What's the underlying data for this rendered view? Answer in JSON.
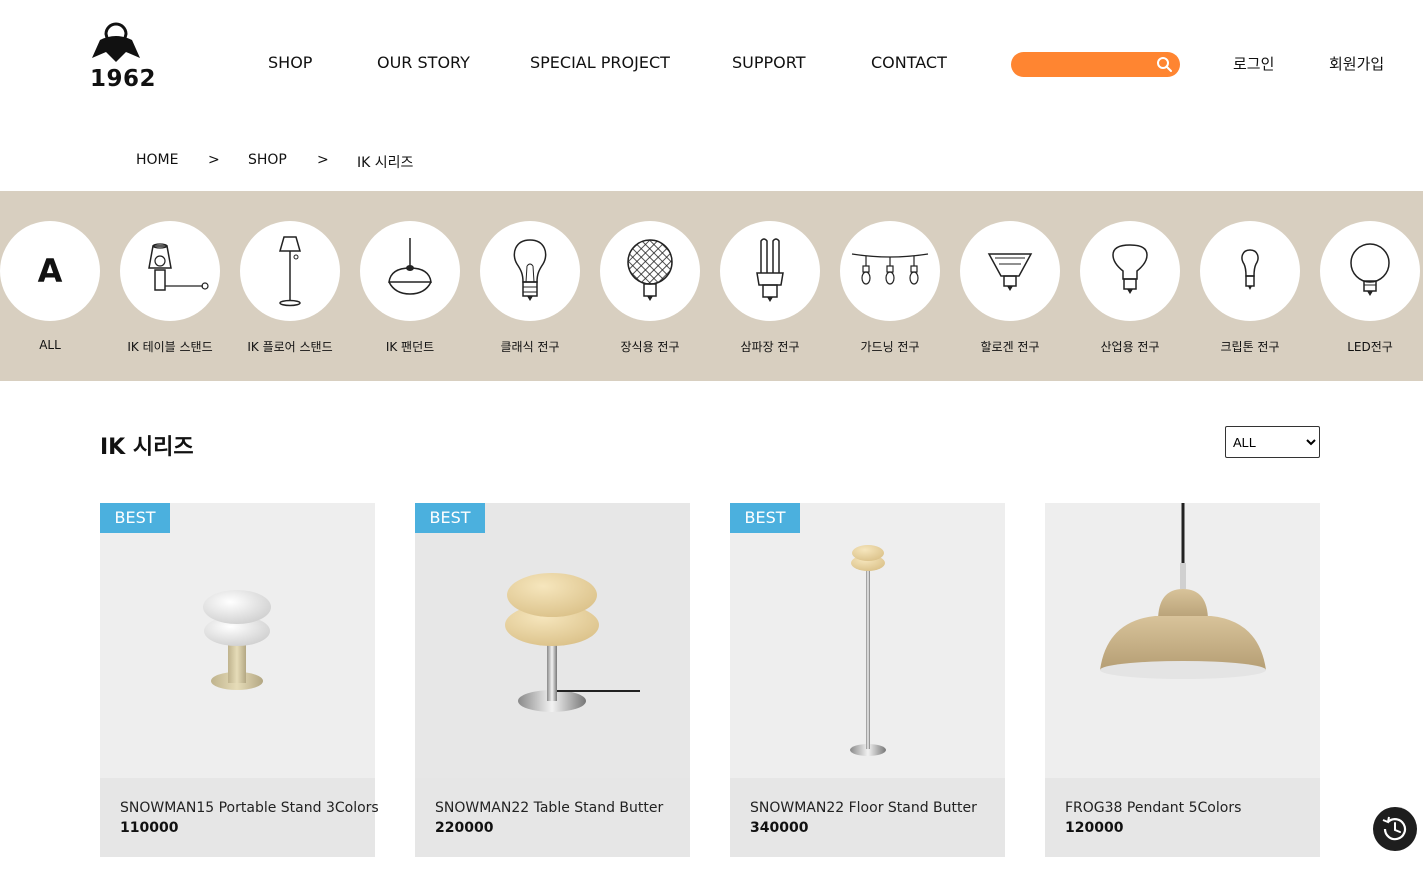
{
  "brand": {
    "year": "1962"
  },
  "nav": {
    "items": [
      {
        "label": "SHOP"
      },
      {
        "label": "OUR STORY"
      },
      {
        "label": "SPECIAL PROJECT"
      },
      {
        "label": "SUPPORT"
      },
      {
        "label": "CONTACT"
      }
    ]
  },
  "search": {
    "placeholder": "",
    "value": ""
  },
  "auth": {
    "login": "로그인",
    "signup": "회원가입"
  },
  "breadcrumb": {
    "home": "HOME",
    "sep1": ">",
    "shop": "SHOP",
    "sep2": ">",
    "current": "IK 시리즈"
  },
  "categories": [
    {
      "label": "ALL",
      "icon": "letter-a-icon",
      "glyph": "A"
    },
    {
      "label": "IK 테이블 스탠드",
      "icon": "table-lamp-icon"
    },
    {
      "label": "IK 플로어 스탠드",
      "icon": "floor-lamp-icon"
    },
    {
      "label": "IK 팬던트",
      "icon": "pendant-lamp-icon"
    },
    {
      "label": "클래식 전구",
      "icon": "classic-bulb-icon"
    },
    {
      "label": "장식용 전구",
      "icon": "decorative-bulb-icon"
    },
    {
      "label": "삼파장 전구",
      "icon": "cfl-bulb-icon"
    },
    {
      "label": "가드닝 전구",
      "icon": "string-lights-icon"
    },
    {
      "label": "할로겐 전구",
      "icon": "halogen-bulb-icon"
    },
    {
      "label": "산업용 전구",
      "icon": "industrial-bulb-icon"
    },
    {
      "label": "크립톤 전구",
      "icon": "krypton-bulb-icon"
    },
    {
      "label": "LED전구",
      "icon": "led-bulb-icon"
    }
  ],
  "section": {
    "title": "IK 시리즈"
  },
  "sort": {
    "selected": "ALL"
  },
  "products": [
    {
      "name": "SNOWMAN15 Portable Stand 3Colors",
      "price": "110000",
      "badge": "BEST"
    },
    {
      "name": "SNOWMAN22 Table Stand Butter",
      "price": "220000",
      "badge": "BEST"
    },
    {
      "name": "SNOWMAN22 Floor Stand Butter",
      "price": "340000",
      "badge": "BEST"
    },
    {
      "name": "FROG38 Pendant 5Colors",
      "price": "120000",
      "badge": ""
    }
  ],
  "colors": {
    "accent": "#ff8531",
    "badge": "#4bb0de",
    "band": "#d8cfc0"
  }
}
